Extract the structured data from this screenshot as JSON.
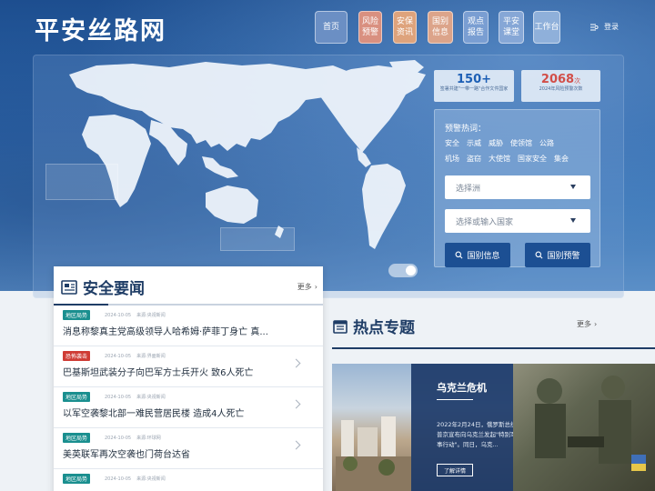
{
  "site": {
    "logo": "平安丝路网"
  },
  "nav": [
    {
      "id": "nav-home",
      "label": "首页"
    },
    {
      "id": "nav-risk",
      "label": "风险预警"
    },
    {
      "id": "nav-sec",
      "label": "安保资讯"
    },
    {
      "id": "nav-intel",
      "label": "国别信息"
    },
    {
      "id": "nav-rep",
      "label": "观点报告"
    },
    {
      "id": "nav-cls",
      "label": "平安课堂"
    },
    {
      "id": "nav-work",
      "label": "工作台"
    }
  ],
  "header": {
    "login": "登录"
  },
  "stats": [
    {
      "num": "150+",
      "unit": "",
      "label": "签署共建\"一带一路\"合作文件国家"
    },
    {
      "num": "2068",
      "unit": "次",
      "label": "2024年风险预警次数"
    }
  ],
  "search": {
    "hot_title": "预警热词：",
    "hot_row1": [
      "安全",
      "示威",
      "威胁",
      "使领馆",
      "公路"
    ],
    "hot_row2": [
      "机场",
      "盗窃",
      "大使馆",
      "国家安全",
      "集会"
    ],
    "continent_placeholder": "选择洲",
    "country_placeholder": "选择或输入国家",
    "btn_info": "国别信息",
    "btn_warn": "国别预警"
  },
  "news": {
    "title": "安全要闻",
    "more": "更多",
    "items": [
      {
        "tag": "地区局势",
        "tag_color": "teal",
        "date": "2024-10-05",
        "source": "来源:央视新闻",
        "title": "消息称黎真主党高级领导人哈希姆·萨菲丁身亡 真..."
      },
      {
        "tag": "恐怖袭击",
        "tag_color": "red",
        "date": "2024-10-05",
        "source": "来源:界面新闻",
        "title": "巴基斯坦武装分子向巴军方士兵开火 致6人死亡"
      },
      {
        "tag": "地区局势",
        "tag_color": "teal",
        "date": "2024-10-05",
        "source": "来源:央视新闻",
        "title": "以军空袭黎北部一难民营居民楼 造成4人死亡"
      },
      {
        "tag": "地区局势",
        "tag_color": "teal",
        "date": "2024-10-05",
        "source": "来源:环球网",
        "title": "美英联军再次空袭也门荷台达省"
      },
      {
        "tag": "地区局势",
        "tag_color": "teal",
        "date": "2024-10-05",
        "source": "来源:央视新闻",
        "title": ""
      }
    ]
  },
  "hot": {
    "title": "热点专题",
    "more": "更多",
    "topic_title": "乌克兰危机",
    "topic_desc": "2022年2月24日，俄罗斯总统普京宣布向乌克兰发起\"特别军事行动\"。同日，乌克...",
    "topic_btn": "了解详情"
  },
  "colors": {
    "primary": "#1c4f93",
    "accent_red": "#d24e48",
    "tag_teal": "#1a8f8f"
  }
}
